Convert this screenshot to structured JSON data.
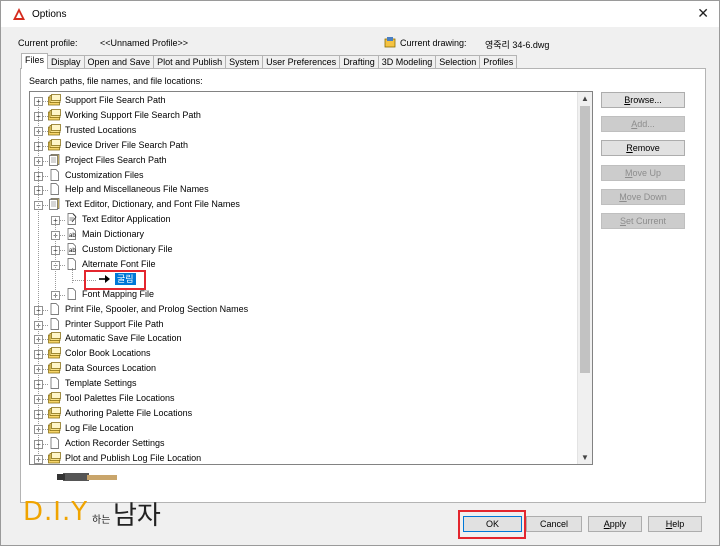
{
  "window": {
    "title": "Options",
    "close_glyph": "✕"
  },
  "profile": {
    "label": "Current profile:",
    "value": "<<Unnamed Profile>>"
  },
  "drawing": {
    "label": "Current drawing:",
    "value": "영죽리 34-6.dwg"
  },
  "tabs": [
    {
      "label": "Files",
      "active": true
    },
    {
      "label": "Display"
    },
    {
      "label": "Open and Save"
    },
    {
      "label": "Plot and Publish"
    },
    {
      "label": "System"
    },
    {
      "label": "User Preferences"
    },
    {
      "label": "Drafting"
    },
    {
      "label": "3D Modeling"
    },
    {
      "label": "Selection"
    },
    {
      "label": "Profiles"
    }
  ],
  "panel": {
    "caption": "Search paths, file names, and file locations:"
  },
  "tree": [
    {
      "label": "Support File Search Path",
      "icon": "folder-stack-icon",
      "level": 0,
      "expander": "+"
    },
    {
      "label": "Working Support File Search Path",
      "icon": "folder-stack-icon",
      "level": 0,
      "expander": "+"
    },
    {
      "label": "Trusted Locations",
      "icon": "folder-stack-icon",
      "level": 0,
      "expander": "+"
    },
    {
      "label": "Device Driver File Search Path",
      "icon": "folder-stack-icon",
      "level": 0,
      "expander": "+"
    },
    {
      "label": "Project Files Search Path",
      "icon": "document-stack-icon",
      "level": 0,
      "expander": "+"
    },
    {
      "label": "Customization Files",
      "icon": "document-icon",
      "level": 0,
      "expander": "+"
    },
    {
      "label": "Help and Miscellaneous File Names",
      "icon": "document-icon",
      "level": 0,
      "expander": "+"
    },
    {
      "label": "Text Editor, Dictionary, and Font File Names",
      "icon": "document-stack-icon",
      "level": 0,
      "expander": "−"
    },
    {
      "label": "Text Editor Application",
      "icon": "text-file-icon",
      "level": 1,
      "expander": "+"
    },
    {
      "label": "Main Dictionary",
      "icon": "dictionary-icon",
      "level": 1,
      "expander": "+"
    },
    {
      "label": "Custom Dictionary File",
      "icon": "dictionary-icon",
      "level": 1,
      "expander": "+"
    },
    {
      "label": "Alternate Font File",
      "icon": "document-icon",
      "level": 1,
      "expander": "−"
    },
    {
      "label": "굴림",
      "icon": "arrow-right-icon",
      "level": 2,
      "expander": "",
      "selected": true
    },
    {
      "label": "Font Mapping File",
      "icon": "document-icon",
      "level": 1,
      "expander": "+"
    },
    {
      "label": "Print File, Spooler, and Prolog Section Names",
      "icon": "document-icon",
      "level": 0,
      "expander": "+"
    },
    {
      "label": "Printer Support File Path",
      "icon": "document-icon",
      "level": 0,
      "expander": "+"
    },
    {
      "label": "Automatic Save File Location",
      "icon": "folder-stack-icon",
      "level": 0,
      "expander": "+"
    },
    {
      "label": "Color Book Locations",
      "icon": "folder-stack-icon",
      "level": 0,
      "expander": "+"
    },
    {
      "label": "Data Sources Location",
      "icon": "folder-stack-icon",
      "level": 0,
      "expander": "+"
    },
    {
      "label": "Template Settings",
      "icon": "document-icon",
      "level": 0,
      "expander": "+"
    },
    {
      "label": "Tool Palettes File Locations",
      "icon": "folder-stack-icon",
      "level": 0,
      "expander": "+"
    },
    {
      "label": "Authoring Palette File Locations",
      "icon": "folder-stack-icon",
      "level": 0,
      "expander": "+"
    },
    {
      "label": "Log File Location",
      "icon": "folder-stack-icon",
      "level": 0,
      "expander": "+"
    },
    {
      "label": "Action Recorder Settings",
      "icon": "document-icon",
      "level": 0,
      "expander": "+"
    },
    {
      "label": "Plot and Publish Log File Location",
      "icon": "folder-stack-icon",
      "level": 0,
      "expander": "+"
    }
  ],
  "side_buttons": [
    {
      "label": "Browse...",
      "key": "B",
      "rest": "rowse...",
      "enabled": true
    },
    {
      "label": "Add...",
      "key": "A",
      "rest": "dd...",
      "enabled": false
    },
    {
      "label": "Remove",
      "key": "R",
      "rest": "emove",
      "enabled": true
    },
    {
      "label": "Move Up",
      "key": "M",
      "rest": "ove Up",
      "enabled": false
    },
    {
      "label": "Move Down",
      "key": "M",
      "rest": "ove Down",
      "enabled": false
    },
    {
      "label": "Set Current",
      "key": "S",
      "rest": "et Current",
      "enabled": false
    }
  ],
  "footer": {
    "ok": "OK",
    "cancel": "Cancel",
    "apply": "Apply",
    "help": "Help"
  },
  "watermark": {
    "diy": "D.I.Y",
    "small": "하는",
    "big": "남자"
  },
  "colors": {
    "selection": "#0078d7",
    "highlight_box": "#e3262e",
    "logo_orange": "#f0a400"
  }
}
